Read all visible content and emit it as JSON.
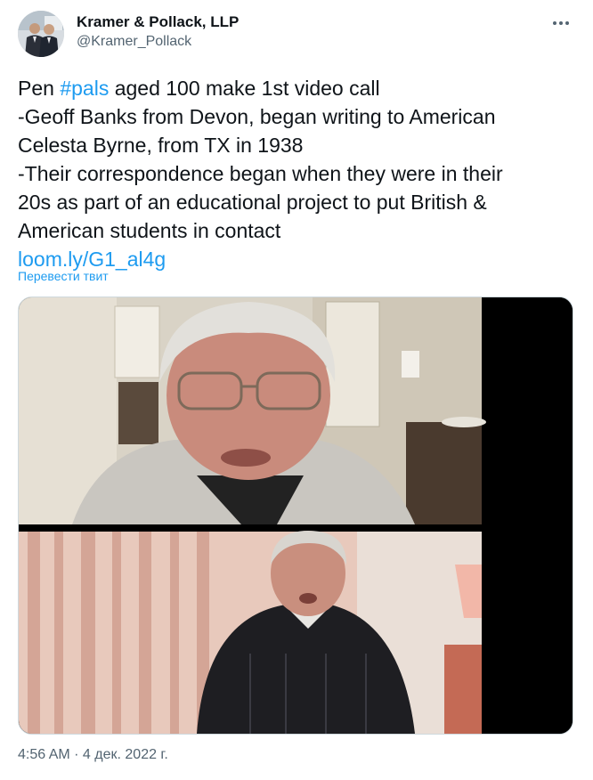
{
  "tweet": {
    "author": {
      "display_name": "Kramer & Pollack, LLP",
      "handle": "@Kramer_Pollack",
      "avatar_icon": "avatar-photo-two-men"
    },
    "more_icon": "more-horizontal-icon",
    "text_lines": {
      "line1_prefix": "Pen ",
      "line1_hashtag": "#pals",
      "line1_suffix": " aged 100 make 1st video call",
      "line2": "-Geoff Banks from Devon, began writing to American",
      "line3": "Celesta Byrne, from TX in 1938",
      "line4": "-Their correspondence began when they were in their",
      "line5": "20s as part of an educational project to put British &",
      "line6": "American students in contact",
      "link": "loom.ly/G1_al4g"
    },
    "translate_label": "Перевести твит",
    "media": {
      "type": "video-call-screenshot",
      "panels": [
        "elderly-woman-with-glasses",
        "elderly-man-in-dark-sweater"
      ]
    },
    "timestamp": "4:56 AM · 4 дек. 2022 г."
  },
  "colors": {
    "link": "#1d9bf0",
    "text": "#0f1419",
    "secondary": "#536471"
  }
}
